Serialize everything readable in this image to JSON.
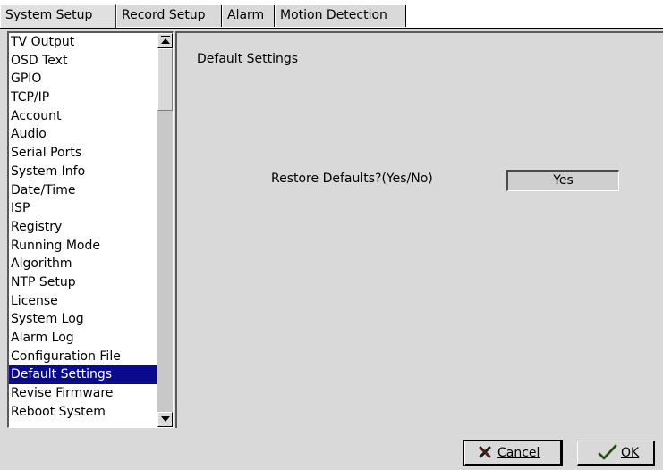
{
  "tabs": [
    {
      "label": "System Setup",
      "active": true
    },
    {
      "label": "Record Setup",
      "active": false
    },
    {
      "label": "Alarm",
      "active": false
    },
    {
      "label": "Motion Detection",
      "active": false
    }
  ],
  "sidebar": {
    "items": [
      {
        "label": "TV Output"
      },
      {
        "label": "OSD Text"
      },
      {
        "label": "GPIO"
      },
      {
        "label": "TCP/IP"
      },
      {
        "label": "Account"
      },
      {
        "label": "Audio"
      },
      {
        "label": "Serial Ports"
      },
      {
        "label": "System Info"
      },
      {
        "label": "Date/Time"
      },
      {
        "label": "ISP"
      },
      {
        "label": "Registry"
      },
      {
        "label": "Running Mode"
      },
      {
        "label": "Algorithm"
      },
      {
        "label": "NTP Setup"
      },
      {
        "label": "License"
      },
      {
        "label": "System Log"
      },
      {
        "label": "Alarm Log"
      },
      {
        "label": "Configuration File"
      },
      {
        "label": "Default Settings",
        "selected": true
      },
      {
        "label": "Revise Firmware"
      },
      {
        "label": "Reboot System"
      }
    ]
  },
  "content": {
    "title": "Default Settings",
    "restore_label": "Restore Defaults?(Yes/No)",
    "restore_value": "Yes"
  },
  "buttons": {
    "cancel_label": "Cancel",
    "ok_label": "OK",
    "cancel_icon": "x-mark-icon",
    "ok_icon": "checkmark-icon"
  },
  "colors": {
    "selection": "#0a0a8c",
    "panel": "#d9d9d9"
  }
}
